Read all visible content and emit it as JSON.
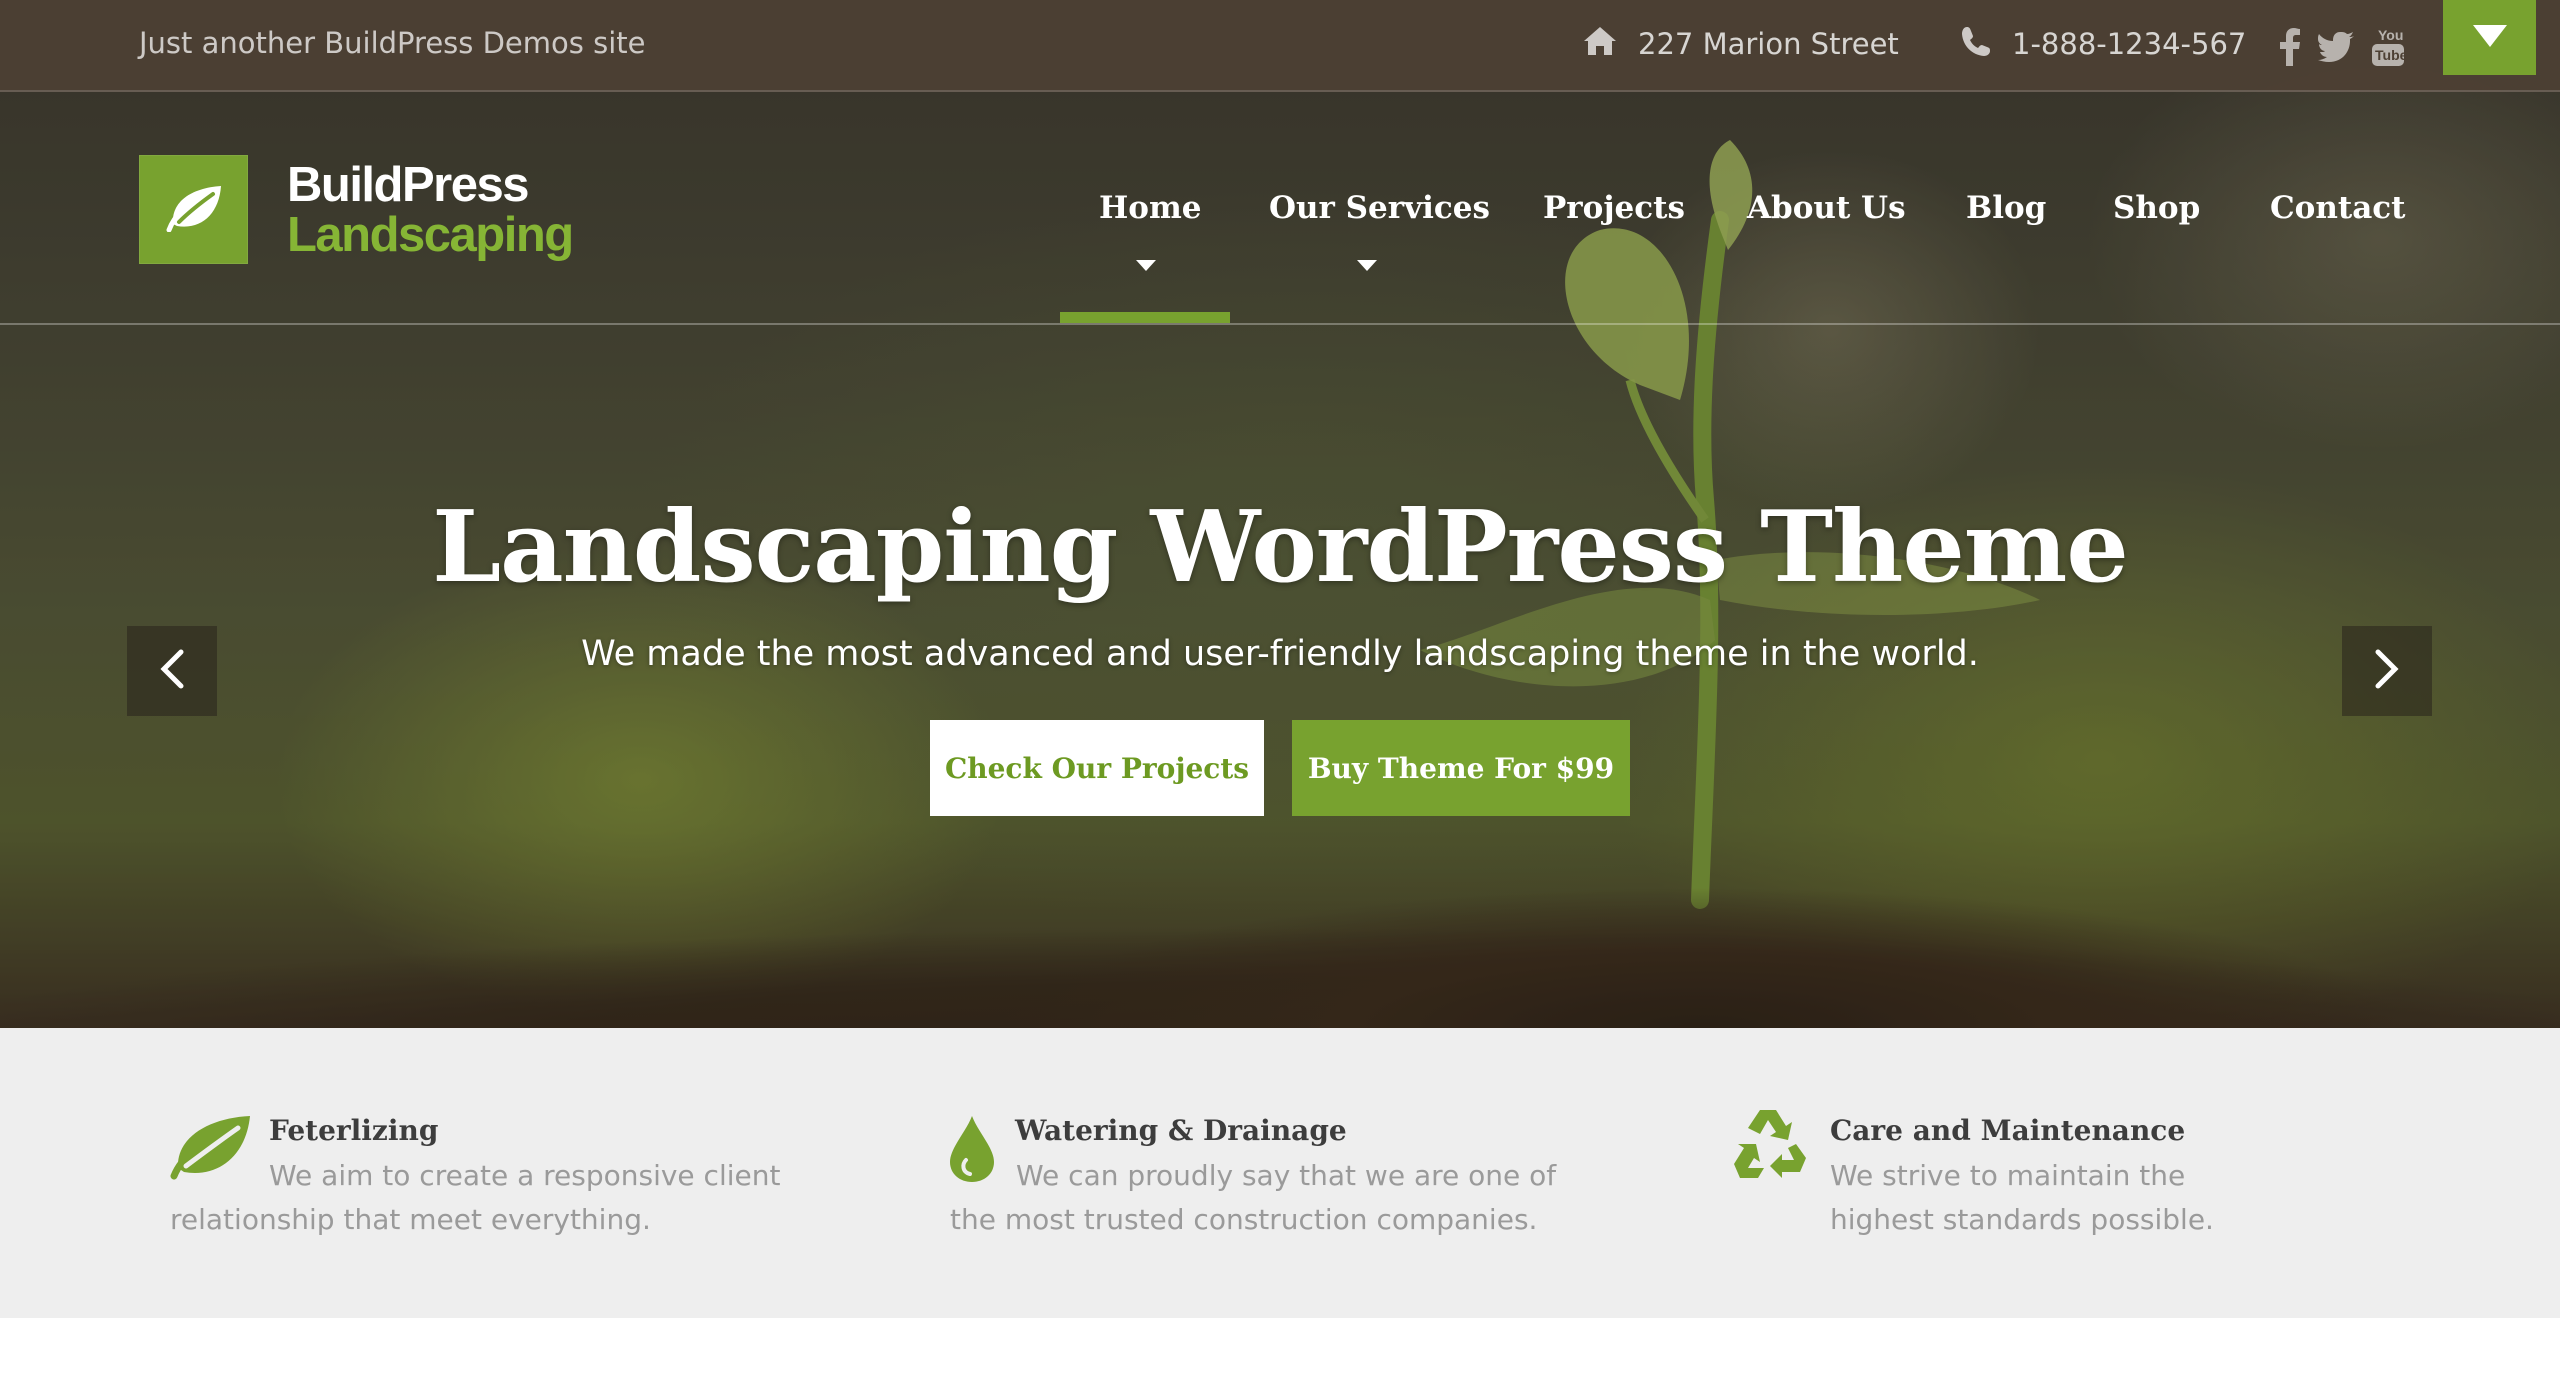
{
  "topbar": {
    "tagline": "Just another BuildPress Demos site",
    "address": "227 Marion Street",
    "phone": "1-888-1234-567",
    "socials": [
      "facebook-icon",
      "twitter-icon",
      "youtube-icon"
    ],
    "accent_color": "#78a22f"
  },
  "logo": {
    "line1": "BuildPress",
    "line2": "Landscaping"
  },
  "nav": {
    "items": [
      {
        "label": "Home",
        "active": true,
        "has_dropdown": true
      },
      {
        "label": "Our Services",
        "active": false,
        "has_dropdown": true
      },
      {
        "label": "Projects",
        "active": false,
        "has_dropdown": false
      },
      {
        "label": "About Us",
        "active": false,
        "has_dropdown": false
      },
      {
        "label": "Blog",
        "active": false,
        "has_dropdown": false
      },
      {
        "label": "Shop",
        "active": false,
        "has_dropdown": false
      },
      {
        "label": "Contact",
        "active": false,
        "has_dropdown": false
      }
    ]
  },
  "slider": {
    "title": "Landscaping WordPress Theme",
    "subtitle": "We made the most advanced and user-friendly landscaping theme in the world.",
    "primary_button": "Check Our Projects",
    "secondary_button": "Buy Theme For $99"
  },
  "features": [
    {
      "icon": "leaf-icon",
      "title": "Feterlizing",
      "text": "We aim to create a responsive client relationship that meet everything."
    },
    {
      "icon": "water-drop-icon",
      "title": "Watering & Drainage",
      "text": "We can proudly say that we are one of the most trusted construction companies."
    },
    {
      "icon": "recycle-icon",
      "title": "Care and Maintenance",
      "text": "We strive to maintain the highest standards possible."
    }
  ]
}
